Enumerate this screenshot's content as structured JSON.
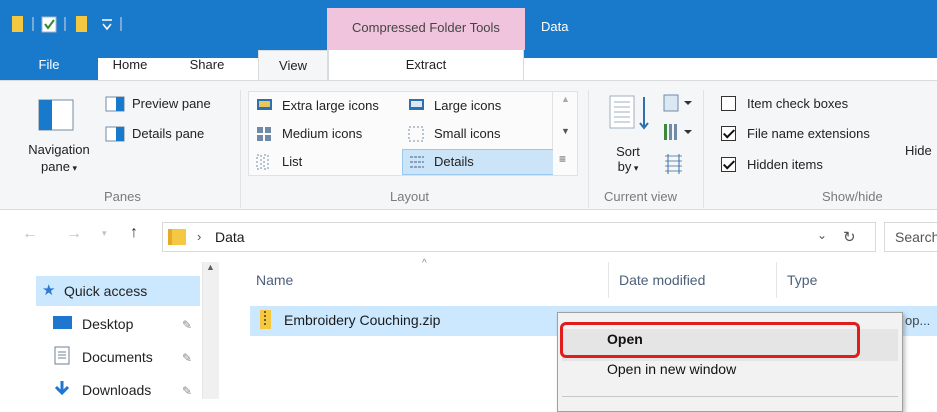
{
  "titlebar": {
    "contextual_group": "Compressed Folder Tools",
    "window_title": "Data",
    "accent": "#1979ca",
    "contextual_color": "#f0c4dd"
  },
  "tabs": {
    "file": "File",
    "home": "Home",
    "share": "Share",
    "view": "View",
    "extract": "Extract"
  },
  "ribbon": {
    "panes": {
      "navigation_pane": "Navigation",
      "navigation_pane2": "pane",
      "preview_pane": "Preview pane",
      "details_pane": "Details pane",
      "group": "Panes"
    },
    "layout": {
      "extra_large_icons": "Extra large icons",
      "large_icons": "Large icons",
      "medium_icons": "Medium icons",
      "small_icons": "Small icons",
      "list": "List",
      "details": "Details",
      "group": "Layout"
    },
    "current_view": {
      "sort": "Sort",
      "by": "by",
      "group": "Current view"
    },
    "show_hide": {
      "item_check_boxes": "Item check boxes",
      "item_check_boxes_checked": false,
      "file_name_extensions": "File name extensions",
      "file_name_extensions_checked": true,
      "hidden_items": "Hidden items",
      "hidden_items_checked": true,
      "hide": "Hide",
      "group": "Show/hide"
    }
  },
  "address": {
    "path_separator": "›",
    "folder": "Data",
    "search_placeholder": "Search"
  },
  "nav_pane": {
    "quick_access": "Quick access",
    "items": [
      {
        "label": "Desktop",
        "icon": "desktop-icon"
      },
      {
        "label": "Documents",
        "icon": "documents-icon"
      },
      {
        "label": "Downloads",
        "icon": "downloads-icon"
      }
    ]
  },
  "file_list": {
    "columns": [
      "Name",
      "Date modified",
      "Type"
    ],
    "rows": [
      {
        "name": "Embroidery Couching.zip",
        "type_truncated": "op..."
      }
    ]
  },
  "context_menu": {
    "items": [
      "Open",
      "Open in new window"
    ],
    "highlight_color": "#e01c1c"
  }
}
